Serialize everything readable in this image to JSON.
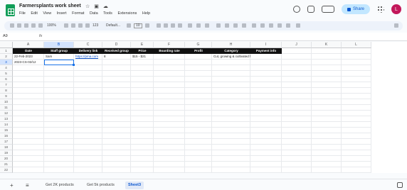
{
  "app": {
    "doc_title": "Farmersplants work sheet",
    "menu": [
      "File",
      "Edit",
      "View",
      "Insert",
      "Format",
      "Data",
      "Tools",
      "Extensions",
      "Help"
    ],
    "share_label": "Share",
    "avatar_initial": "L",
    "accent_color": "#0f9d58"
  },
  "toolbar": {
    "zoom": "100%",
    "number_format": "123",
    "font": "Default...",
    "font_size": "10"
  },
  "formula_bar": {
    "name_box": "A9",
    "fx": "fx",
    "value": ""
  },
  "grid": {
    "columns": [
      "A",
      "B",
      "C",
      "D",
      "E",
      "F",
      "G",
      "H",
      "I",
      "J",
      "K",
      "L"
    ],
    "rows": [
      "1",
      "2",
      "3",
      "4",
      "5",
      "6",
      "7",
      "8",
      "9",
      "10",
      "11",
      "12",
      "13",
      "14",
      "15",
      "16",
      "17",
      "18",
      "19",
      "20",
      "21",
      "22"
    ],
    "header_row": [
      "Date",
      "Staff group",
      "Delivery link",
      "Received group",
      "Price",
      "Boarding rate",
      "Profit",
      "Category",
      "Payment info"
    ],
    "row2": [
      "22-Feb-2023",
      "Sam",
      "https://pma.com",
      "8",
      "$15 - $21",
      "",
      "",
      "Cut, growing & cultivated food",
      ""
    ],
    "row3": [
      "2023-CS-02/12",
      "",
      "",
      "",
      "",
      "",
      "",
      "",
      ""
    ]
  },
  "sheets": {
    "tabs": [
      "Get 2K products",
      "Get 5k products",
      "Sheet3"
    ],
    "active": "Sheet3"
  }
}
